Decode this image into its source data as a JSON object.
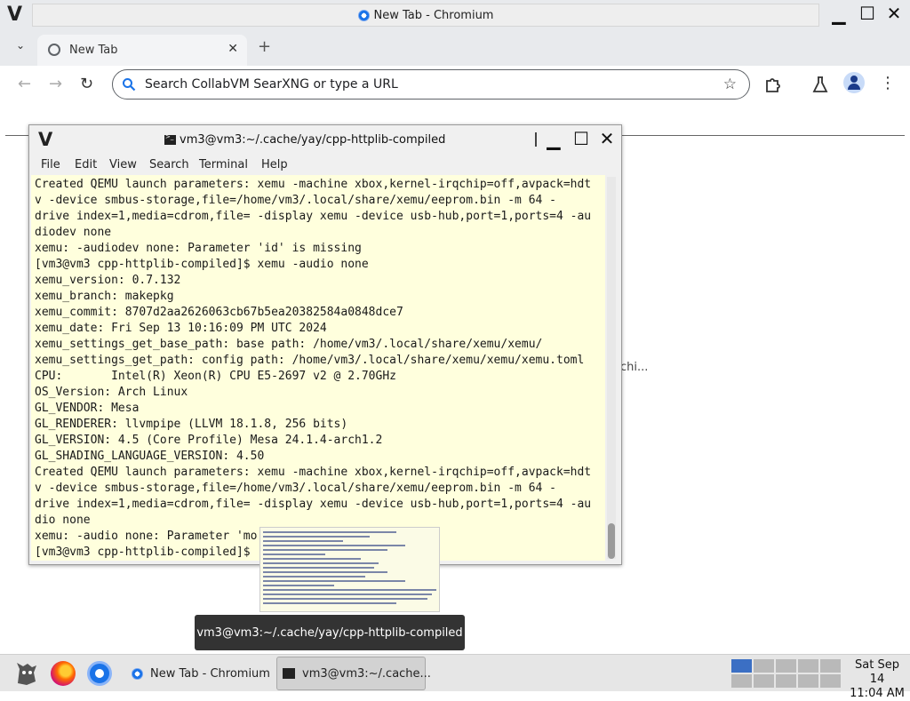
{
  "chromium": {
    "window_title": "New Tab - Chromium",
    "tab_label": "New Tab",
    "omnibox_placeholder": "Search CollabVM SearXNG or type a URL",
    "bg_snippet": "chi..."
  },
  "terminal": {
    "title": "vm3@vm3:~/.cache/yay/cpp-httplib-compiled",
    "menu": [
      "File",
      "Edit",
      "View",
      "Search",
      "Terminal",
      "Help"
    ],
    "lines": [
      "Created QEMU launch parameters: xemu -machine xbox,kernel-irqchip=off,avpack=hdt",
      "v -device smbus-storage,file=/home/vm3/.local/share/xemu/eeprom.bin -m 64 -",
      "drive index=1,media=cdrom,file= -display xemu -device usb-hub,port=1,ports=4 -au",
      "diodev none",
      "xemu: -audiodev none: Parameter 'id' is missing",
      "[vm3@vm3 cpp-httplib-compiled]$ xemu -audio none",
      "xemu_version: 0.7.132",
      "xemu_branch: makepkg",
      "xemu_commit: 8707d2aa2626063cb67b5ea20382584a0848dce7",
      "xemu_date: Fri Sep 13 10:16:09 PM UTC 2024",
      "xemu_settings_get_base_path: base path: /home/vm3/.local/share/xemu/xemu/",
      "xemu_settings_get_path: config path: /home/vm3/.local/share/xemu/xemu/xemu.toml",
      "CPU:       Intel(R) Xeon(R) CPU E5-2697 v2 @ 2.70GHz",
      "OS_Version: Arch Linux",
      "GL_VENDOR: Mesa",
      "GL_RENDERER: llvmpipe (LLVM 18.1.8, 256 bits)",
      "GL_VERSION: 4.5 (Core Profile) Mesa 24.1.4-arch1.2",
      "GL_SHADING_LANGUAGE_VERSION: 4.50",
      "Created QEMU launch parameters: xemu -machine xbox,kernel-irqchip=off,avpack=hdt",
      "v -device smbus-storage,file=/home/vm3/.local/share/xemu/eeprom.bin -m 64 -",
      "drive index=1,media=cdrom,file= -display xemu -device usb-hub,port=1,ports=4 -au",
      "dio none",
      "xemu: -audio none: Parameter 'mo",
      "[vm3@vm3 cpp-httplib-compiled]$"
    ]
  },
  "tooltip": "vm3@vm3:~/.cache/yay/cpp-httplib-compiled",
  "taskbar": {
    "tasks": [
      "New Tab - Chromium",
      "vm3@vm3:~/.cache..."
    ],
    "clock_date": "Sat Sep 14",
    "clock_time": "11:04 AM"
  },
  "icons": [
    "app-logo-icon",
    "globe-icon",
    "chevron-down-icon",
    "plus-icon",
    "back-arrow-icon",
    "forward-arrow-icon",
    "reload-icon",
    "search-icon",
    "star-icon",
    "extensions-icon",
    "labs-flask-icon",
    "profile-icon",
    "kebab-menu-icon",
    "terminal-icon",
    "minimize-icon",
    "maximize-icon",
    "close-icon",
    "fox-launcher-icon",
    "firefox-icon",
    "chromium-icon"
  ]
}
